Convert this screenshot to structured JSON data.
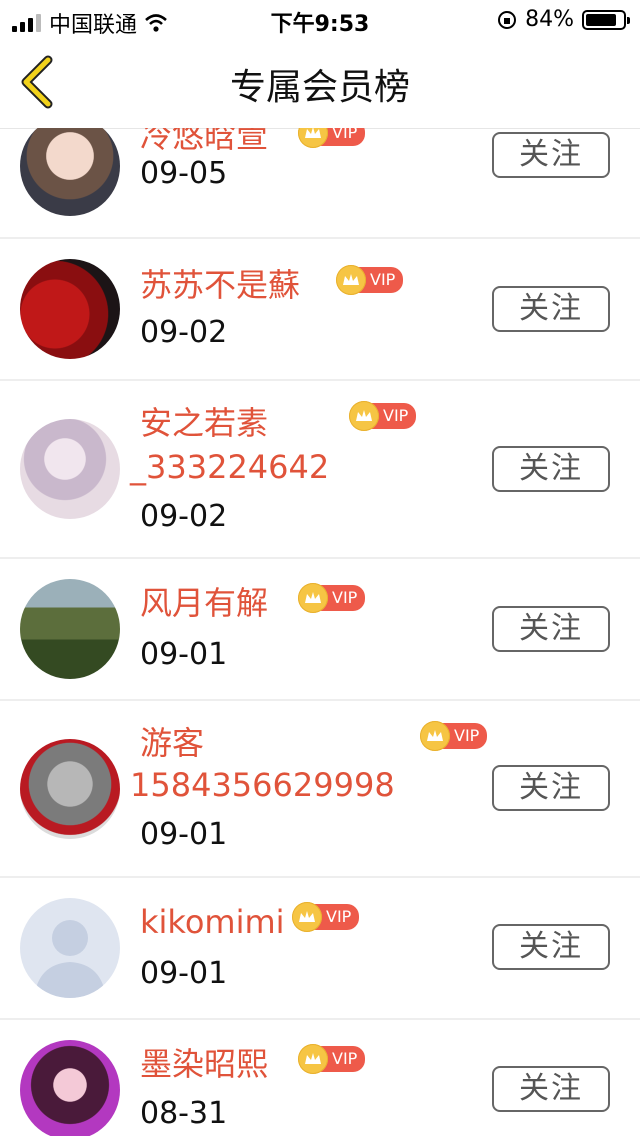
{
  "status_bar": {
    "carrier": "中国联通",
    "time": "下午9:53",
    "battery": "84%",
    "battery_level": 0.84
  },
  "header": {
    "title": "专属会员榜",
    "back_icon": "chevron-left-icon",
    "accent_color": "#f2b400"
  },
  "badge": {
    "vip_label": "VIP",
    "crown_icon": "crown-icon"
  },
  "follow_label": "关注",
  "members": [
    {
      "name": "冷悠晗萱",
      "date": "09-05"
    },
    {
      "name": "苏苏不是蘇",
      "date": "09-02"
    },
    {
      "name": "安之若素",
      "name_line2": "_333224642",
      "date": "09-02"
    },
    {
      "name": "风月有解",
      "date": "09-01"
    },
    {
      "name": "游客",
      "name_line2": "1584356629998",
      "date": "09-01"
    },
    {
      "name": "kikomimi",
      "date": "09-01"
    },
    {
      "name": "墨染昭熙",
      "date": "08-31"
    }
  ],
  "colors": {
    "name": "#e0533a",
    "vip_tag": "#ee5a4a",
    "crown": "#f6c544"
  }
}
